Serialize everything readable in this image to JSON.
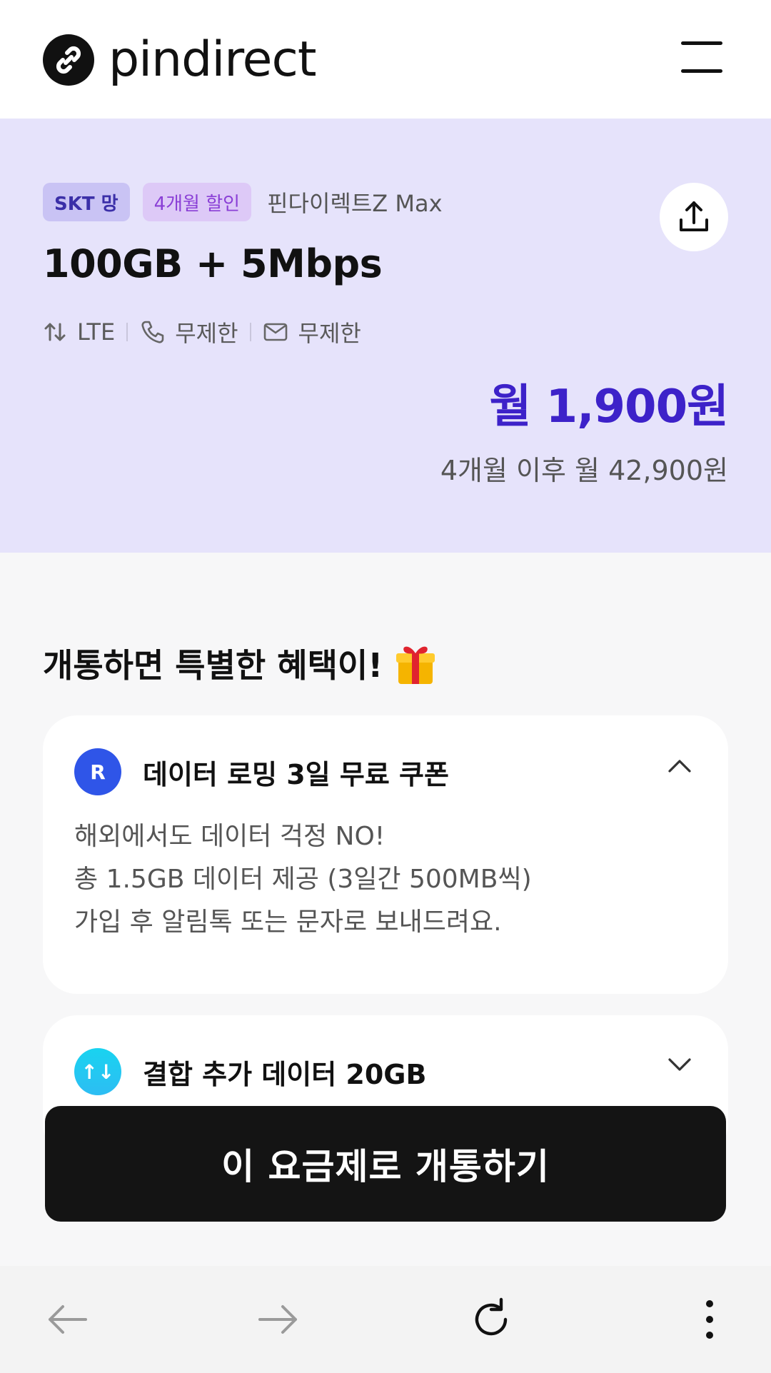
{
  "header": {
    "logo_text": "pindirect",
    "menu_icon": "hamburger-menu-icon"
  },
  "plan": {
    "tags": [
      "SKT 망",
      "4개월 할인"
    ],
    "name": "핀다이렉트Z Max",
    "title": "100GB + 5Mbps",
    "specs": {
      "network": "LTE",
      "calls": "무제한",
      "messages": "무제한"
    },
    "price_main": "월 1,900원",
    "price_after": "4개월 이후 월 42,900원",
    "share_icon": "share-upload-icon"
  },
  "benefits": {
    "heading": "개통하면 특별한 혜택이!",
    "heading_icon": "gift-icon",
    "items": [
      {
        "title": "데이터 로밍 3일 무료 쿠폰",
        "icon_letter": "R",
        "expanded": true,
        "lines": [
          "해외에서도 데이터 걱정 NO!",
          "총 1.5GB 데이터 제공 (3일간 500MB씩)",
          "가입 후 알림톡 또는 문자로 보내드려요."
        ]
      },
      {
        "title": "결합 추가 데이터 20GB",
        "icon_letter": "↑↓",
        "expanded": false
      }
    ]
  },
  "cta": {
    "label": "이 요금제로 개통하기"
  },
  "browser_nav": {
    "buttons": [
      "back-arrow-icon",
      "forward-arrow-icon",
      "reload-icon",
      "more-vertical-icon"
    ]
  },
  "colors": {
    "hero_bg": "#e6e3fb",
    "price_accent": "#3d22c9",
    "cta_bg": "#141414",
    "roaming_icon": "#2f55e8",
    "data_icon": "#19d3f0"
  }
}
